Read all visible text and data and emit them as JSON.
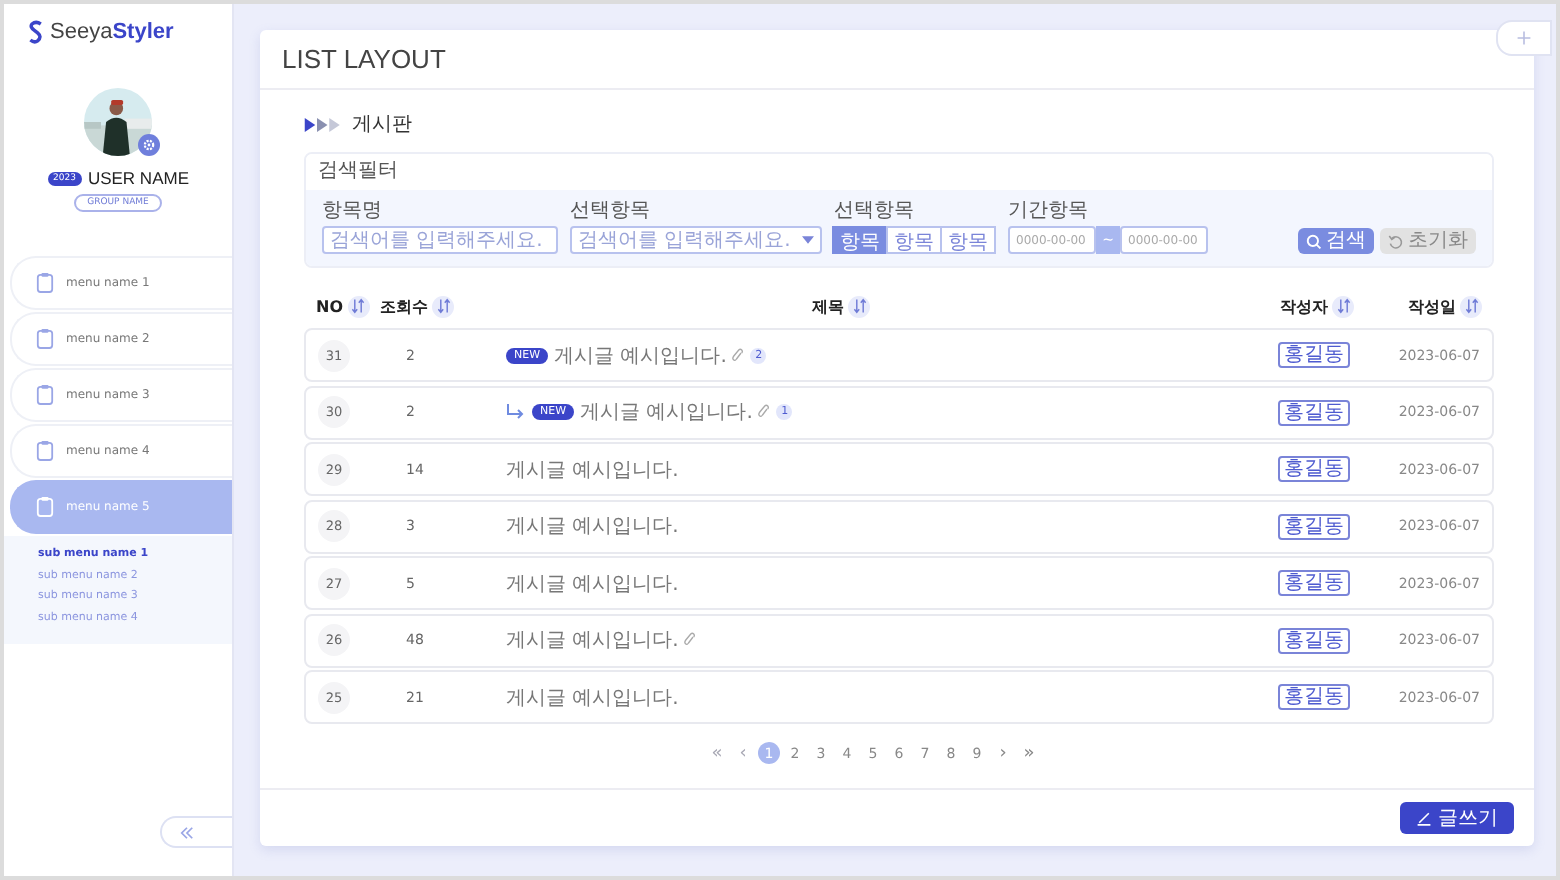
{
  "logo": {
    "plain": "Seeya",
    "bold": "Styler"
  },
  "user": {
    "badge": "2023",
    "name": "USER NAME",
    "group": "GROUP NAME"
  },
  "menu": [
    {
      "label": "menu name 1",
      "selected": false
    },
    {
      "label": "menu name 2",
      "selected": false
    },
    {
      "label": "menu name 3",
      "selected": false
    },
    {
      "label": "menu name 4",
      "selected": false
    },
    {
      "label": "menu name 5",
      "selected": true,
      "children": [
        {
          "label": "sub menu name 1",
          "selected": true
        },
        {
          "label": "sub menu name 2",
          "selected": false
        },
        {
          "label": "sub menu name 3",
          "selected": false
        },
        {
          "label": "sub menu name 4",
          "selected": false
        }
      ]
    }
  ],
  "page_title": "LIST LAYOUT",
  "breadcrumb": "게시판",
  "filter": {
    "title": "검색필터",
    "text_field": {
      "label": "항목명",
      "placeholder": "검색어를 입력해주세요."
    },
    "select_field": {
      "label": "선택항목",
      "placeholder": "검색어를 입력해주세요."
    },
    "segment": {
      "label": "선택항목",
      "options": [
        {
          "label": "항목",
          "selected": true
        },
        {
          "label": "항목",
          "selected": false
        },
        {
          "label": "항목",
          "selected": false
        }
      ]
    },
    "date_range": {
      "label": "기간항목",
      "start_placeholder": "0000-00-00",
      "separator": "~",
      "end_placeholder": "0000-00-00"
    },
    "search_button": "검색",
    "reset_button": "초기화"
  },
  "table": {
    "columns": [
      "NO",
      "조회수",
      "제목",
      "작성자",
      "작성일"
    ],
    "rows": [
      {
        "no": "31",
        "views": "2",
        "reply": false,
        "new_badge": "NEW",
        "title": "게시글 예시입니다.",
        "attachment": true,
        "comments": "2",
        "writer": "홍길동",
        "date": "2023-06-07"
      },
      {
        "no": "30",
        "views": "2",
        "reply": true,
        "new_badge": "NEW",
        "title": "게시글 예시입니다.",
        "attachment": true,
        "comments": "1",
        "writer": "홍길동",
        "date": "2023-06-07"
      },
      {
        "no": "29",
        "views": "14",
        "reply": false,
        "title": "게시글 예시입니다.",
        "attachment": false,
        "writer": "홍길동",
        "date": "2023-06-07"
      },
      {
        "no": "28",
        "views": "3",
        "reply": false,
        "title": "게시글 예시입니다.",
        "attachment": false,
        "writer": "홍길동",
        "date": "2023-06-07"
      },
      {
        "no": "27",
        "views": "5",
        "reply": false,
        "title": "게시글 예시입니다.",
        "attachment": false,
        "writer": "홍길동",
        "date": "2023-06-07"
      },
      {
        "no": "26",
        "views": "48",
        "reply": false,
        "title": "게시글 예시입니다.",
        "attachment": true,
        "writer": "홍길동",
        "date": "2023-06-07"
      },
      {
        "no": "25",
        "views": "21",
        "reply": false,
        "title": "게시글 예시입니다.",
        "attachment": false,
        "writer": "홍길동",
        "date": "2023-06-07"
      }
    ]
  },
  "pagination": {
    "first": {
      "label": "«",
      "disabled": true
    },
    "prev": {
      "label": "‹",
      "disabled": true
    },
    "pages": [
      {
        "label": "1",
        "selected": true
      },
      {
        "label": "2",
        "selected": false
      },
      {
        "label": "3",
        "selected": false
      },
      {
        "label": "4",
        "selected": false
      },
      {
        "label": "5",
        "selected": false
      },
      {
        "label": "6",
        "selected": false
      },
      {
        "label": "7",
        "selected": false
      },
      {
        "label": "8",
        "selected": false
      },
      {
        "label": "9",
        "selected": false
      }
    ],
    "next": {
      "label": "›",
      "disabled": false
    },
    "last": {
      "label": "»",
      "disabled": false
    }
  },
  "write_button": "글쓰기"
}
